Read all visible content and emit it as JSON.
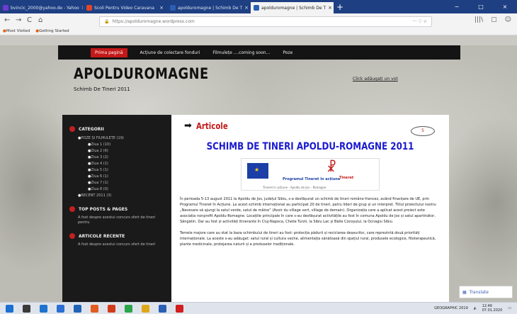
{
  "browser": {
    "tabs": [
      {
        "label": "bvincic_2000@yahoo.de - Yahoo",
        "color": "#6d3bd1"
      },
      {
        "label": "Scoli Pentru Video Caravana",
        "color": "#e1452c"
      },
      {
        "label": "apolduromagne | Schimb De T",
        "color": "#2b5fb3"
      },
      {
        "label": "apolduromagne | Schimb De T",
        "color": "#2b5fb3"
      }
    ],
    "tab_close": "×",
    "new_tab": "+",
    "window_buttons": [
      "−",
      "□",
      "×"
    ],
    "nav": {
      "back": "←",
      "forward": "→",
      "reload": "C",
      "home": "⌂"
    },
    "url": "https://apolduromagne.wordpress.com",
    "url_actions": "··· ♡ ☆",
    "toolbar_icons": [
      "|||\\",
      "▢",
      "☺",
      "≡"
    ],
    "bookmarks": [
      "Most Visited",
      "Getting Started"
    ]
  },
  "site": {
    "nav": [
      "Prima pagină",
      "Acțiune de colectare fonduri",
      "Filmulețe ....coming soon...",
      "Poze"
    ],
    "title": "APOLDUROMAGNE",
    "tagline": "Schimb De Tineri 2011",
    "search": "Click adăugați un vot"
  },
  "sidebar": {
    "categories_title": "CATEGORII",
    "categories": [
      "POZE ȘI FILMULEȚE (19)",
      "Ziua 1 (10)",
      "Ziua 2 (6)",
      "Ziua 3 (2)",
      "Ziua 4 (1)",
      "Ziua 5 (1)",
      "Ziua 6 (1)",
      "Ziua 7 (1)",
      "Ziua 8 (0)",
      "RECENT 2011 (3)"
    ],
    "top_posts_title": "TOP POSTS & PAGES",
    "top_posts_note": "A fost despre acestui concurs sfert de tineri pentru",
    "recent_title": "ARTICOLE RECENTE",
    "recent_note": "A fost despre acestui concurs sfert de tineri"
  },
  "content": {
    "section_title": "Articole",
    "comment_count": "5",
    "post_title": "SCHIMB DE TINERI APOLDU-ROMAGNE 2011",
    "banner_program": "Programul Tineret în acțiune",
    "banner_tineret": "Tineret",
    "banner_sub": "Tineret în acțiune · Apoldu de Jos – Romagne",
    "para1": "În perioada 5-13 august 2011 la Apoldu de Jos, județul Sibiu, s-a desfășurat un schimb de tineri româno-francez, având finanțare de UE, prin Programul Tineret în Acțiune. La acest schimb internațional au participat 20 de tineri, patru lideri de grup și un interpret. Titlul proiectului nostru „Necesare să ajungi la satul verde, satul de mâine” (Avoir du village vert, village de demain). Organizația care a aplicat acest proiect este asociația nonprofit Apoldu-Romagne. Locațiile principale în care s-au desfășurat activitățile au fost în comuna Apoldu de Jos și satul apartinător, Sângătin. Dar au fost și activități itinerante în Cluj-Napoca, Cheile Turzii, la Sibiu Lac și Băile Cocoșului, la Ocnagiu Sibiu.",
    "para2": "Temele majore care au stat la baza schimbului de tineri au fost: protecția pădurii și reciclarea deșeurilor, care reprezintă două priorități internaționale. La aceste s-au adăugat: satul rural și cultura veche, alimentația sănătoasă din spațiul rural, produsele ecologice, fitoterapeutică, plante medicinale, protejarea naturii și a produselor tradiționale."
  },
  "translate": "Translate",
  "taskbar": {
    "apps": [
      {
        "name": "start",
        "color": "#1a6fd1"
      },
      {
        "name": "taskview",
        "color": "#3a3a3a"
      },
      {
        "name": "edge",
        "color": "#1c74d0"
      },
      {
        "name": "store",
        "color": "#2b6fd4"
      },
      {
        "name": "mail",
        "color": "#1f63b8"
      },
      {
        "name": "firefox",
        "color": "#e25c22"
      },
      {
        "name": "office",
        "color": "#d13b1a"
      },
      {
        "name": "chrome",
        "color": "#2aa54a"
      },
      {
        "name": "paint",
        "color": "#e0a71a"
      },
      {
        "name": "word",
        "color": "#2b5fb3"
      },
      {
        "name": "pdf",
        "color": "#d11f1f"
      }
    ],
    "lang": "GEOGRAPHIC 2019",
    "time": "12:46",
    "date": "07.01.2020"
  }
}
